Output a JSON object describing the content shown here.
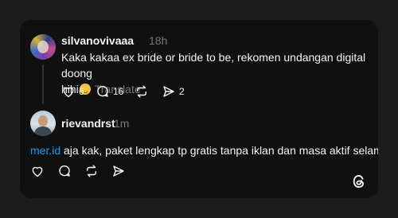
{
  "post": {
    "username": "silvanovivaaa",
    "time": "18h",
    "text_line1": "Kaka kakaa ex bride or bride to be, rekomen undangan digital doong",
    "text_line2": "hihi",
    "emoji": "relieved-face-emoji",
    "translate_label": "Translate",
    "like_count": "6",
    "reply_count": "16",
    "share_count": "2"
  },
  "reply": {
    "username": "rievandrst",
    "time": "1m",
    "mention": "mer.id",
    "text": " aja kak, paket lengkap tp gratis tanpa iklan dan masa aktif selamanyaa"
  },
  "icons": {
    "like": "heart-icon",
    "reply": "comment-icon",
    "repost": "repost-icon",
    "share": "send-icon",
    "brand": "threads-logo-icon"
  },
  "colors": {
    "background": "#1c1c1c",
    "card": "#101010",
    "text": "#f3f5f7",
    "muted": "#777777",
    "link": "#1d9bf0"
  }
}
